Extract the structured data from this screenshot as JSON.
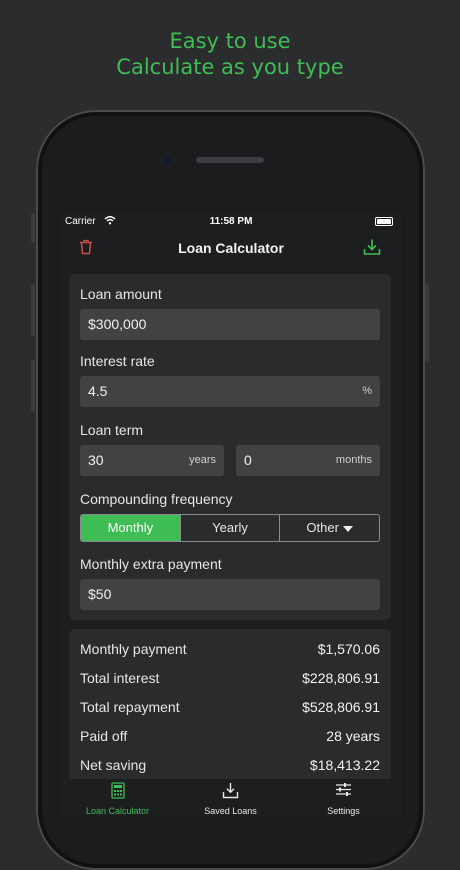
{
  "promo": {
    "line1": "Easy to use",
    "line2": "Calculate as you type"
  },
  "status_bar": {
    "carrier": "Carrier",
    "time": "11:58 PM"
  },
  "nav": {
    "title": "Loan Calculator",
    "left_icon": "trash-icon",
    "right_icon": "download-icon"
  },
  "form": {
    "loan_amount": {
      "label": "Loan amount",
      "value": "$300,000"
    },
    "interest_rate": {
      "label": "Interest rate",
      "value": "4.5",
      "suffix": "%"
    },
    "loan_term": {
      "label": "Loan term",
      "years_value": "30",
      "years_suffix": "years",
      "months_value": "0",
      "months_suffix": "months"
    },
    "compounding": {
      "label": "Compounding frequency",
      "options": [
        "Monthly",
        "Yearly",
        "Other"
      ],
      "selected": "Monthly"
    },
    "extra_payment": {
      "label": "Monthly extra payment",
      "value": "$50"
    }
  },
  "results": [
    {
      "label": "Monthly payment",
      "value": "$1,570.06"
    },
    {
      "label": "Total interest",
      "value": "$228,806.91"
    },
    {
      "label": "Total repayment",
      "value": "$528,806.91"
    },
    {
      "label": "Paid off",
      "value": "28 years"
    },
    {
      "label": "Net saving",
      "value": "$18,413.22"
    }
  ],
  "tabs": [
    {
      "label": "Loan Calculator",
      "icon": "calculator-icon",
      "active": true
    },
    {
      "label": "Saved Loans",
      "icon": "download-tray-icon",
      "active": false
    },
    {
      "label": "Settings",
      "icon": "sliders-icon",
      "active": false
    }
  ],
  "colors": {
    "accent": "#3fbd55",
    "danger": "#d64a4a",
    "background": "#1d1e20",
    "card": "#2a2b2d",
    "field": "#414244"
  }
}
